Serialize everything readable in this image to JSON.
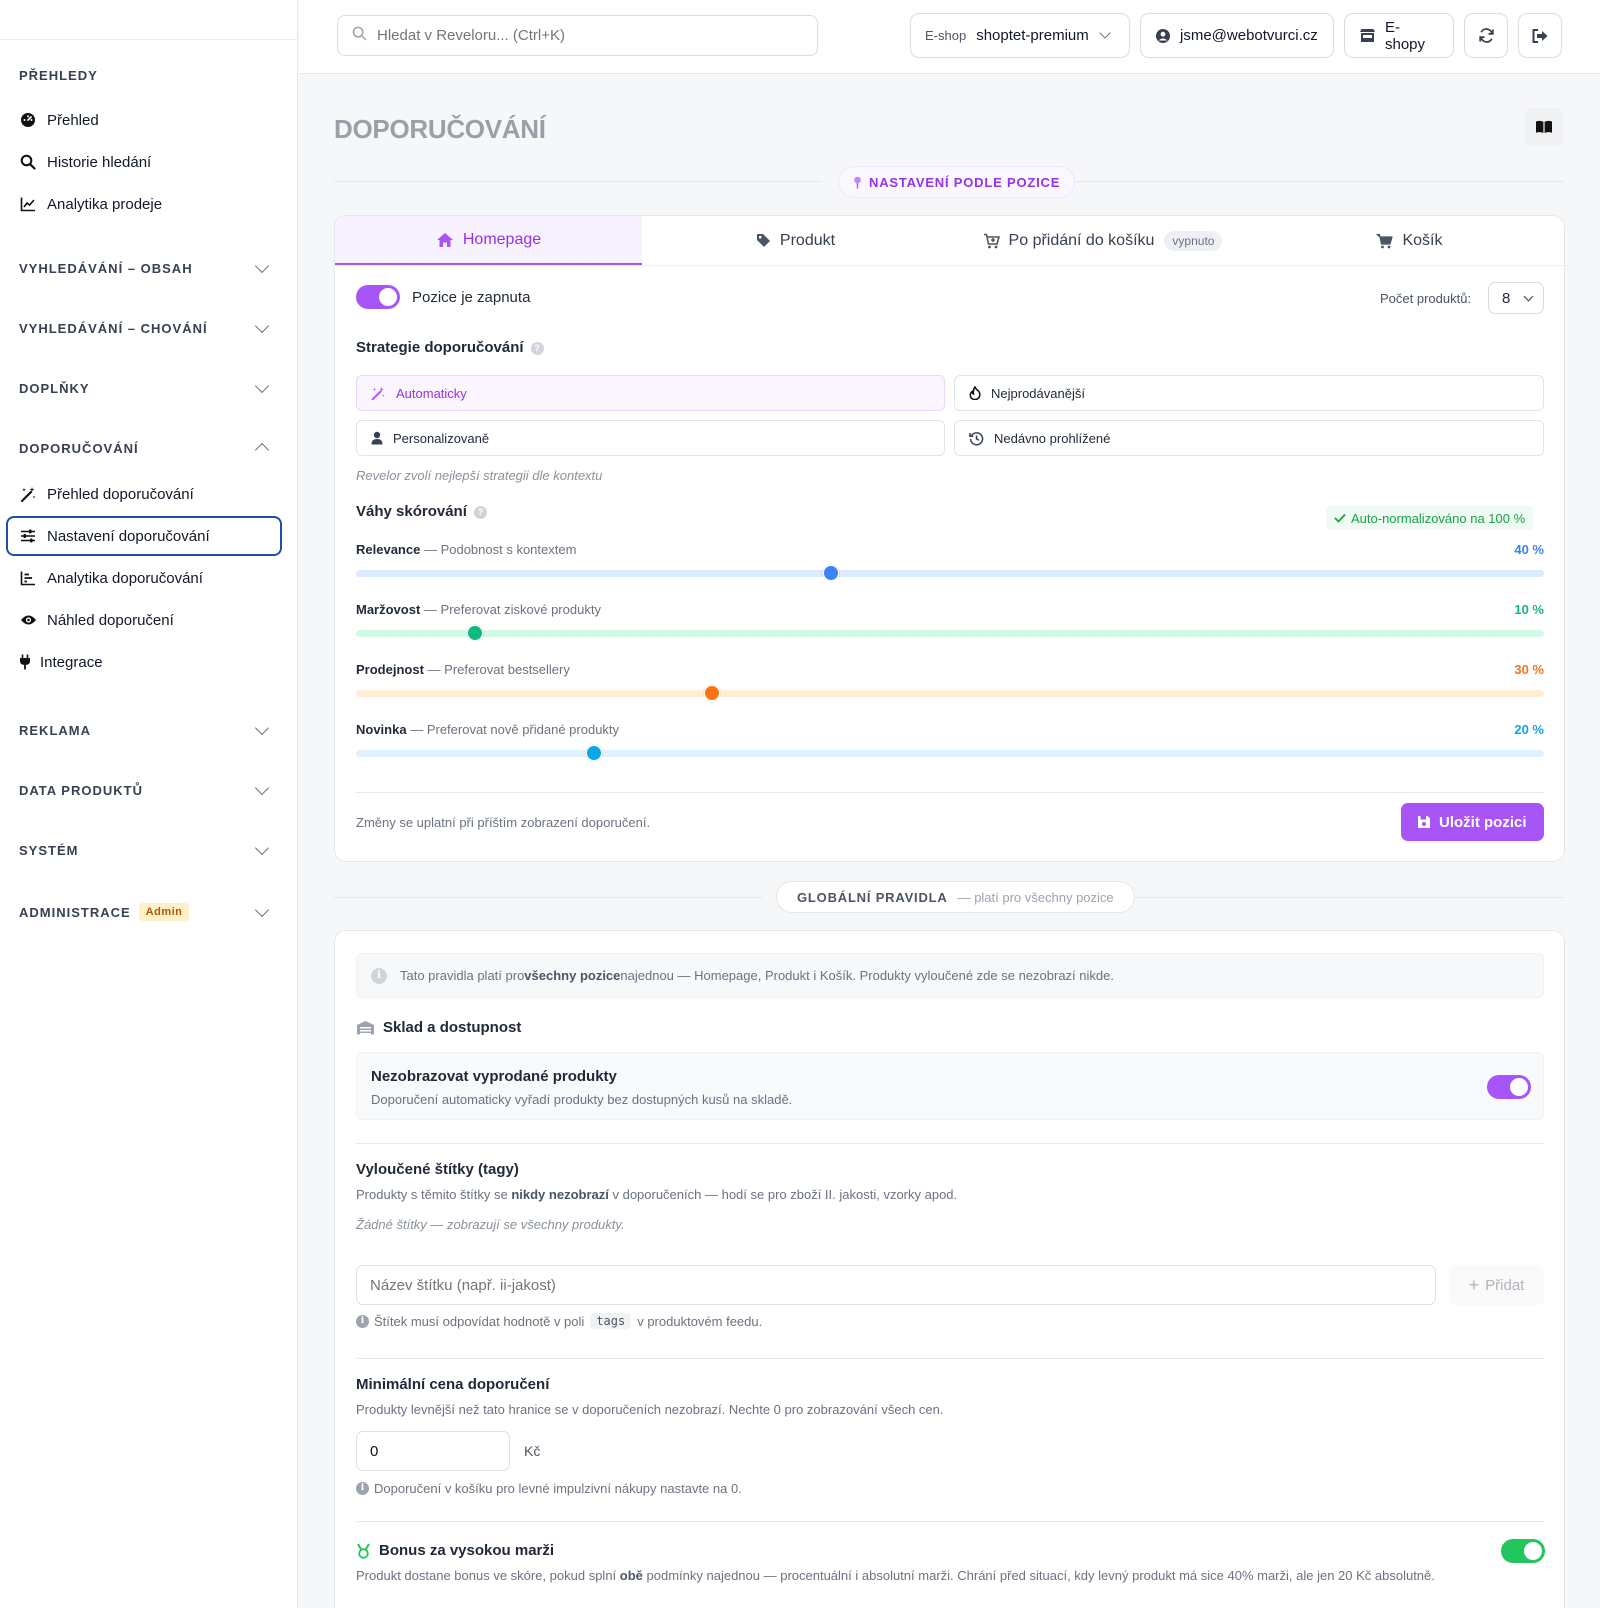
{
  "search": {
    "placeholder": "Hledat v Reveloru... (Ctrl+K)"
  },
  "topbar": {
    "eshop_label": "E-shop",
    "eshop_value": "shoptet-premium",
    "user_email": "jsme@webotvurci.cz",
    "eshops_button": "E-shopy"
  },
  "sidebar": {
    "sections": {
      "overview": "PŘEHLEDY",
      "search_content": "VYHLEDÁVÁNÍ – OBSAH",
      "search_behavior": "VYHLEDÁVÁNÍ – CHOVÁNÍ",
      "addons": "DOPLŇKY",
      "recommendations": "DOPORUČOVÁNÍ",
      "ads": "REKLAMA",
      "product_data": "DATA PRODUKTŮ",
      "system": "SYSTÉM",
      "administration": "ADMINISTRACE",
      "admin_badge": "Admin"
    },
    "items": {
      "overview": "Přehled",
      "search_history": "Historie hledání",
      "sales_analytics": "Analytika prodeje",
      "rec_overview": "Přehled doporučování",
      "rec_settings": "Nastavení doporučování",
      "rec_analytics": "Analytika doporučování",
      "rec_preview": "Náhled doporučení",
      "integration": "Integrace"
    }
  },
  "page": {
    "title": "DOPORUČOVÁNÍ",
    "position_settings_label": "NASTAVENÍ PODLE POZICE",
    "tabs": {
      "homepage": "Homepage",
      "product": "Produkt",
      "after_cart": "Po přidání do košíku",
      "after_cart_badge": "vypnuto",
      "cart": "Košík"
    },
    "position_enabled_label": "Pozice je zapnuta",
    "product_count_label": "Počet produktů:",
    "product_count_value": "8",
    "strategy_title": "Strategie doporučování",
    "strategies": {
      "auto": "Automaticky",
      "bestsellers": "Nejprodávanější",
      "personalized": "Personalizovaně",
      "recently_viewed": "Nedávno prohlížené"
    },
    "strategy_hint": "Revelor zvolí nejlepší strategii dle kontextu",
    "weights_title": "Váhy skórování",
    "auto_normalized": "Auto-normalizováno na 100 %",
    "weights": [
      {
        "name": "Relevance",
        "desc": "— Podobnost s kontextem",
        "value": 40,
        "display": "40 %",
        "color": "#3b82f6",
        "track": "#dbeafe"
      },
      {
        "name": "Maržovost",
        "desc": "— Preferovat ziskové produkty",
        "value": 10,
        "display": "10 %",
        "color": "#10b981",
        "track": "#d1fae5"
      },
      {
        "name": "Prodejnost",
        "desc": "— Preferovat bestsellery",
        "value": 30,
        "display": "30 %",
        "color": "#f97316",
        "track": "#ffedd5"
      },
      {
        "name": "Novinka",
        "desc": "— Preferovat nově přidané produkty",
        "value": 20,
        "display": "20 %",
        "color": "#0ea5e9",
        "track": "#e0f2fe"
      }
    ],
    "changes_note": "Změny se uplatní při příštím zobrazení doporučení.",
    "save_button": "Uložit pozici",
    "global_rules_label": "GLOBÁLNÍ PRAVIDLA",
    "global_rules_suffix": "— platí pro všechny pozice",
    "global_info_1": "Tato pravidla platí pro ",
    "global_info_bold": "všechny pozice",
    "global_info_2": " najednou — Homepage, Produkt i Košík. Produkty vyloučené zde se nezobrazí nikde.",
    "stock_title": "Sklad a dostupnost",
    "hide_soldout_title": "Nezobrazovat vyprodané produkty",
    "hide_soldout_desc": "Doporučení automaticky vyřadí produkty bez dostupných kusů na skladě.",
    "excluded_tags_title": "Vyloučené štítky (tagy)",
    "excluded_tags_desc_1": "Produkty s těmito štítky se ",
    "excluded_tags_desc_bold": "nikdy nezobrazí",
    "excluded_tags_desc_2": " v doporučeních — hodí se pro zboží II. jakosti, vzorky apod.",
    "no_tags": "Žádné štítky — zobrazují se všechny produkty.",
    "tag_input_placeholder": "Název štítku (např. ii-jakost)",
    "add_button": "Přidat",
    "tag_note_1": "Štítek musí odpovídat hodnotě v poli",
    "tag_note_code": "tags",
    "tag_note_2": "v produktovém feedu.",
    "min_price_title": "Minimální cena doporučení",
    "min_price_desc": "Produkty levnější než tato hranice se v doporučeních nezobrazí. Nechte 0 pro zobrazování všech cen.",
    "min_price_value": "0",
    "currency": "Kč",
    "min_price_note": "Doporučení v košíku pro levné impulzivní nákupy nastavte na 0.",
    "margin_bonus_title": "Bonus za vysokou marži",
    "margin_bonus_desc_1": "Produkt dostane bonus ve skóre, pokud splní ",
    "margin_bonus_desc_bold": "obě",
    "margin_bonus_desc_2": " podmínky najednou — procentuální i absolutní marži. Chrání před situací, kdy levný produkt má sice 40% marži, ale jen 20 Kč absolutně."
  }
}
